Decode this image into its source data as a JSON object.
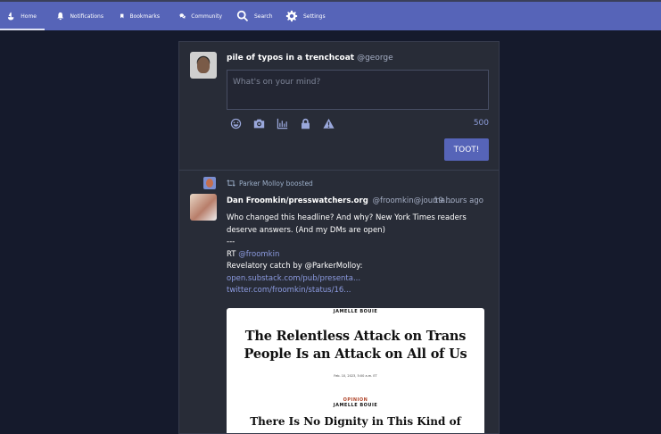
{
  "nav": {
    "home": "Home",
    "notifications": "Notifications",
    "bookmarks": "Bookmarks",
    "community": "Community",
    "search": "Search",
    "settings": "Settings"
  },
  "compose": {
    "display_name": "pile of typos in a trenchcoat",
    "handle": "@george",
    "placeholder": "What's on your mind?",
    "char_count": "500",
    "submit_label": "TOOT!",
    "tools": [
      "emoji-icon",
      "camera-icon",
      "poll-icon",
      "lock-icon",
      "warning-icon"
    ]
  },
  "status": {
    "boosted_by": "Parker Molloy boosted",
    "display_name": "Dan Froomkin/presswatchers.org",
    "acct": "@froomkin@journa...",
    "time": "19 hours ago",
    "lines": [
      "Who changed this headline? And why? New York Times readers",
      "deserve answers. (And my DMs are open)",
      "---"
    ],
    "rt_prefix": "RT",
    "rt_link": "@froomkin",
    "revelatory": "Revelatory catch by @ParkerMolloy:",
    "link1": "open.substack.com/pub/presenta...",
    "link2": "twitter.com/froomkin/status/16...",
    "media": {
      "author": "JAMELLE BOUIE",
      "headline_1": "The Relentless Attack on Trans",
      "headline_2": "People Is an Attack on All of Us",
      "date": "Feb. 10, 2023, 5:00 a.m. ET",
      "opinion": "OPINION",
      "author_2": "JAMELLE BOUIE",
      "headline_partial": "There Is No Dignity in This Kind of"
    }
  },
  "colors": {
    "nav_bg": "#5664b8",
    "page_bg": "#151a2c",
    "column_bg": "#282c37",
    "accent": "#8c9be0"
  }
}
